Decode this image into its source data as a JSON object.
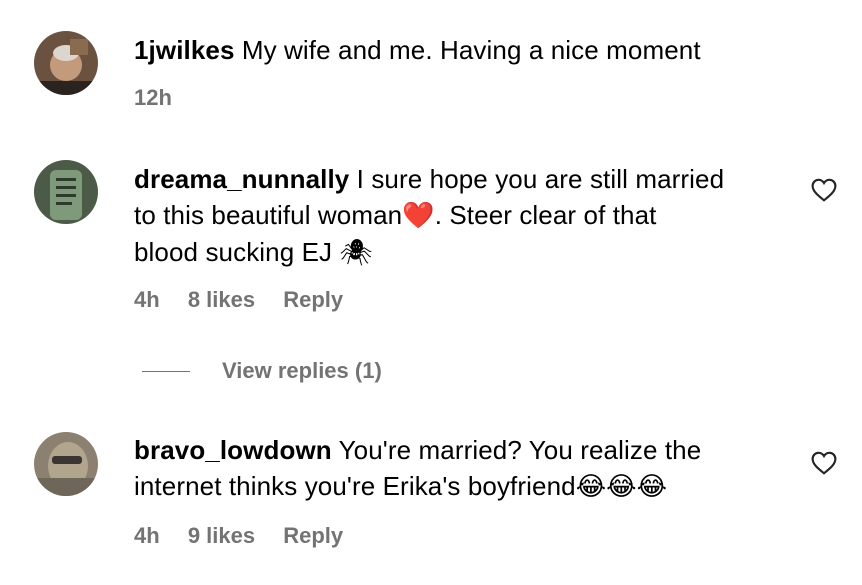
{
  "comments": [
    {
      "username": "1jwilkes",
      "text": " My wife and me. Having a nice moment",
      "time": "12h",
      "likes": "",
      "reply": ""
    },
    {
      "username": "dreama_nunnally",
      "text_line1": " I sure hope you are still married",
      "text_line2": "to this beautiful woman",
      "text_line2b": ". Steer clear of that",
      "text_line3": "blood sucking EJ ",
      "emoji_heart": "❤️",
      "emoji_spider": "🕷",
      "time": "4h",
      "likes": "8 likes",
      "reply": "Reply"
    },
    {
      "username": "bravo_lowdown",
      "text_line1": " You're married? You realize the",
      "text_line2": "internet thinks you're Erika's boyfriend",
      "emoji_laugh": "😂😂😂",
      "time": "4h",
      "likes": "9 likes",
      "reply": "Reply"
    }
  ],
  "view_replies": "View replies (1)",
  "colors": {
    "meta_gray": "#737373",
    "text": "#000000",
    "heart_red": "#e0245e"
  },
  "icons": {
    "like": "heart-outline-icon"
  }
}
